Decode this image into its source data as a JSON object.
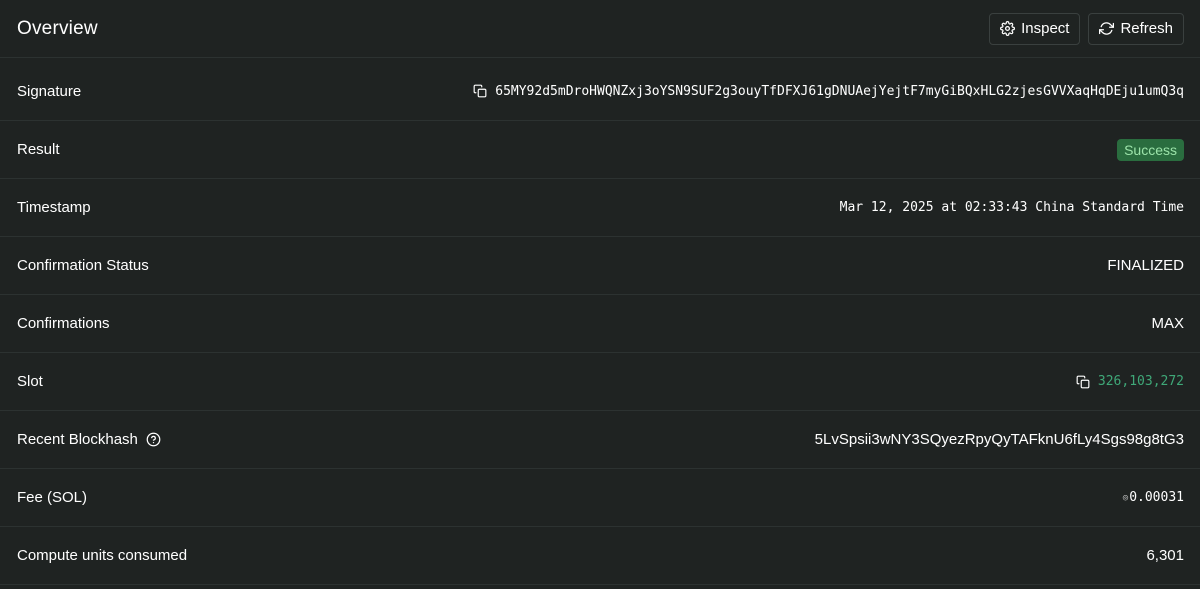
{
  "header": {
    "title": "Overview",
    "inspect_label": "Inspect",
    "refresh_label": "Refresh"
  },
  "rows": {
    "signature": {
      "label": "Signature",
      "value": "65MY92d5mDroHWQNZxj3oYSN9SUF2g3ouyTfDFXJ61gDNUAejYejtF7myGiBQxHLG2zjesGVVXaqHqDEju1umQ3q"
    },
    "result": {
      "label": "Result",
      "value": "Success"
    },
    "timestamp": {
      "label": "Timestamp",
      "value": "Mar 12, 2025 at 02:33:43 China Standard Time"
    },
    "confirmation_status": {
      "label": "Confirmation Status",
      "value": "FINALIZED"
    },
    "confirmations": {
      "label": "Confirmations",
      "value": "MAX"
    },
    "slot": {
      "label": "Slot",
      "value": "326,103,272"
    },
    "recent_blockhash": {
      "label": "Recent Blockhash",
      "value": "5LvSpsii3wNY3SQyezRpyQyTAFknU6fLy4Sgs98g8tG3"
    },
    "fee": {
      "label": "Fee (SOL)",
      "currency_mark": "◎",
      "value": "0.00031"
    },
    "compute_units": {
      "label": "Compute units consumed",
      "value": "6,301"
    }
  },
  "icons": {
    "inspect": "gear-icon",
    "refresh": "refresh-icon",
    "copy": "copy-icon",
    "help": "help-circle-icon"
  },
  "colors": {
    "background": "#1f2322",
    "border": "#2c3231",
    "success_badge_bg": "#2a6d3f",
    "success_badge_text": "#9be3a9",
    "slot_link": "#3fa878"
  }
}
